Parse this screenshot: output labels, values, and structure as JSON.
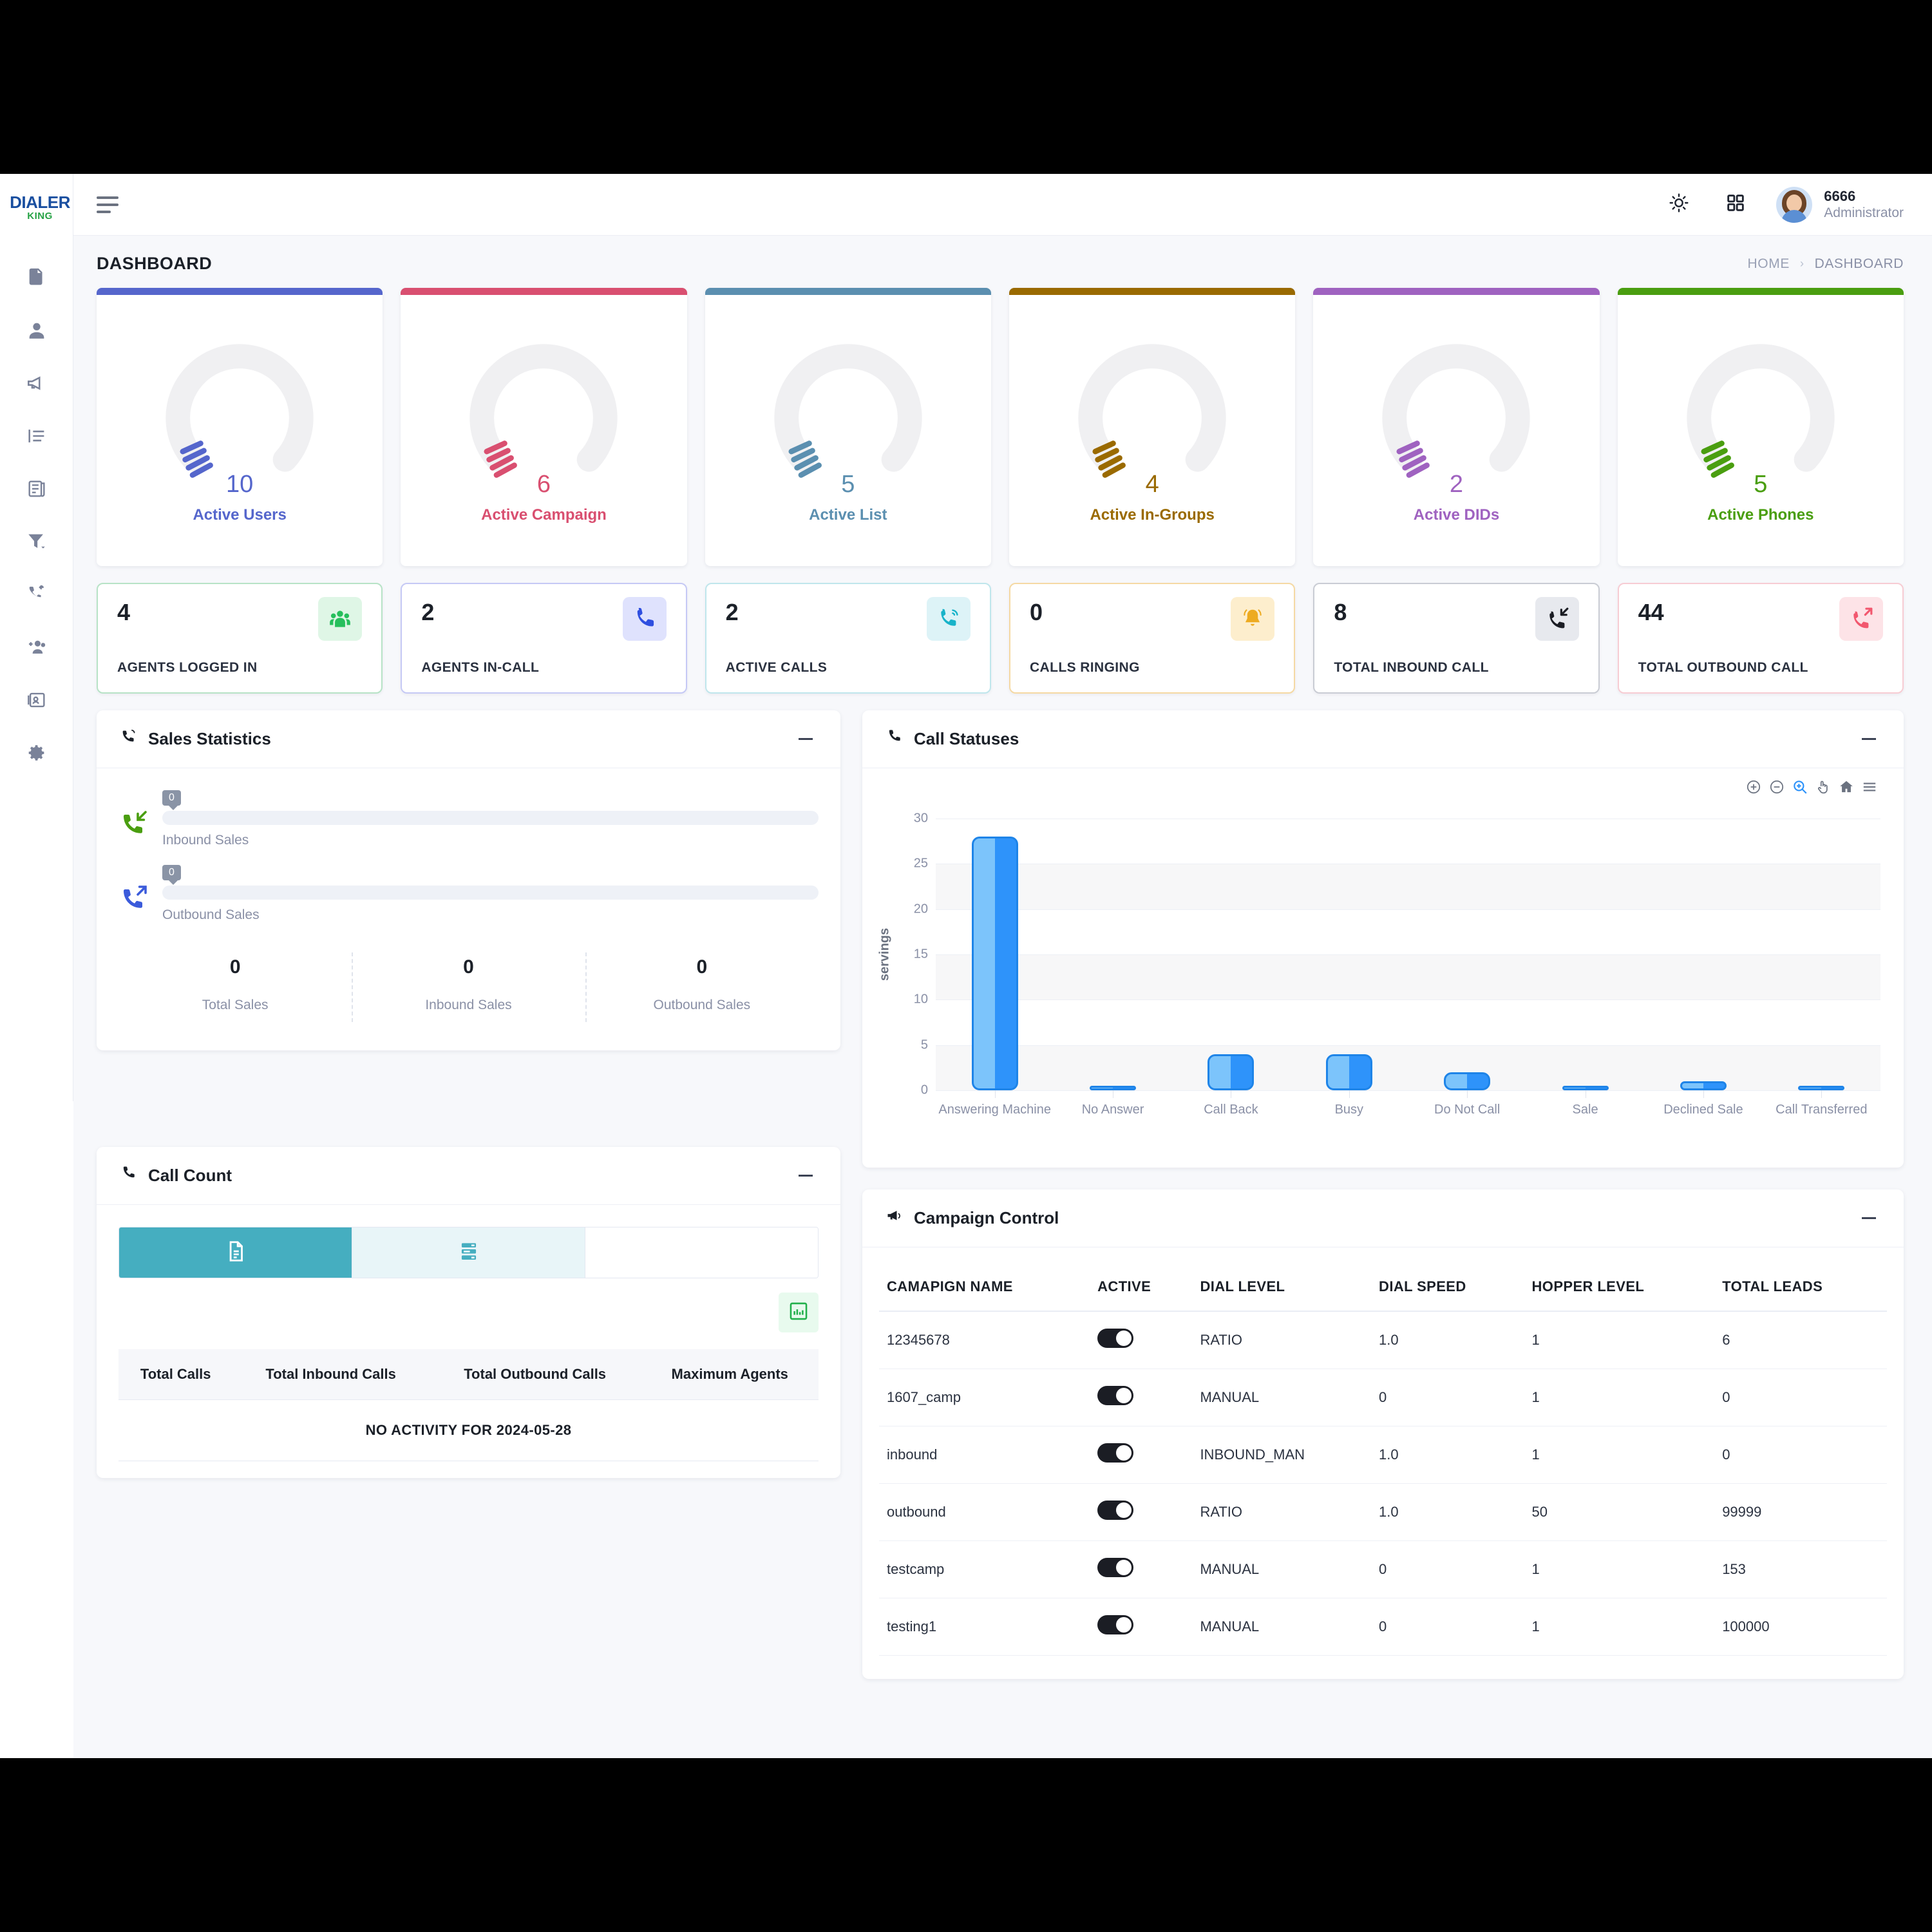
{
  "brand": {
    "main": "DIALER",
    "sub": "KING"
  },
  "sidebar": {
    "items": [
      {
        "name": "sidebar-item-reports",
        "icon": "document-icon"
      },
      {
        "name": "sidebar-item-users",
        "icon": "user-icon"
      },
      {
        "name": "sidebar-item-campaigns",
        "icon": "megaphone-icon"
      },
      {
        "name": "sidebar-item-lists",
        "icon": "list-icon"
      },
      {
        "name": "sidebar-item-scripts",
        "icon": "report-icon"
      },
      {
        "name": "sidebar-item-filters",
        "icon": "filter-icon"
      },
      {
        "name": "sidebar-item-call-transfer",
        "icon": "call-transfer-icon"
      },
      {
        "name": "sidebar-item-add-agents",
        "icon": "add-users-icon"
      },
      {
        "name": "sidebar-item-did",
        "icon": "id-card-icon"
      },
      {
        "name": "sidebar-item-settings",
        "icon": "gear-icon"
      }
    ]
  },
  "header": {
    "theme_icon": "sun-icon",
    "apps_icon": "grid-apps-icon",
    "user_name": "6666",
    "user_role": "Administrator"
  },
  "page": {
    "title": "DASHBOARD",
    "breadcrumb": {
      "home": "HOME",
      "sep": "›",
      "current": "DASHBOARD"
    }
  },
  "gauges": [
    {
      "value": "10",
      "label": "Active Users",
      "color": "#5566cc",
      "accent": "#5566cc"
    },
    {
      "value": "6",
      "label": "Active Campaign",
      "color": "#d94f70",
      "accent": "#d94f70"
    },
    {
      "value": "5",
      "label": "Active List",
      "color": "#5b8fb0",
      "accent": "#5b8fb0"
    },
    {
      "value": "4",
      "label": "Active In-Groups",
      "color": "#9a6a00",
      "accent": "#9a6a00"
    },
    {
      "value": "2",
      "label": "Active DIDs",
      "color": "#9f62c0",
      "accent": "#9f62c0"
    },
    {
      "value": "5",
      "label": "Active Phones",
      "color": "#4a9e10",
      "accent": "#4a9e10"
    }
  ],
  "kpis": [
    {
      "value": "4",
      "label": "AGENTS LOGGED IN",
      "icon": "group-icon",
      "border": "#b7e3c6",
      "badge_bg": "#dff6e6",
      "badge_fg": "#26bf5c"
    },
    {
      "value": "2",
      "label": "AGENTS IN-CALL",
      "icon": "phone-icon",
      "border": "#c5c9f5",
      "badge_bg": "#dfe2fd",
      "badge_fg": "#2f4fe0"
    },
    {
      "value": "2",
      "label": "ACTIVE CALLS",
      "icon": "phone-active-icon",
      "border": "#bfe6ec",
      "badge_bg": "#ddf3f7",
      "badge_fg": "#18b3c9"
    },
    {
      "value": "0",
      "label": "CALLS RINGING",
      "icon": "bell-icon",
      "border": "#f5d9a3",
      "badge_bg": "#fdeecd",
      "badge_fg": "#edab21"
    },
    {
      "value": "8",
      "label": "TOTAL INBOUND CALL",
      "icon": "call-inbound-icon",
      "border": "#c9ccd4",
      "badge_bg": "#e7e9ee",
      "badge_fg": "#1b1d24"
    },
    {
      "value": "44",
      "label": "TOTAL OUTBOUND CALL",
      "icon": "call-outbound-icon",
      "border": "#f7ccd3",
      "badge_bg": "#fde3e7",
      "badge_fg": "#f2586f"
    }
  ],
  "sales": {
    "title": "Sales Statistics",
    "icon": "phone-ring-icon",
    "collapse_icon": "minus-icon",
    "bars": [
      {
        "tooltip": "0",
        "label": "Inbound Sales",
        "icon": "call-inbound-green-icon"
      },
      {
        "tooltip": "0",
        "label": "Outbound Sales",
        "icon": "call-outbound-blue-icon"
      }
    ],
    "totals": [
      {
        "value": "0",
        "label": "Total Sales"
      },
      {
        "value": "0",
        "label": "Inbound Sales"
      },
      {
        "value": "0",
        "label": "Outbound Sales"
      }
    ]
  },
  "call_statuses": {
    "title": "Call Statuses",
    "icon": "phone-icon",
    "collapse_icon": "minus-icon",
    "toolbar": [
      {
        "name": "zoom-in-icon",
        "active": false
      },
      {
        "name": "zoom-out-icon",
        "active": false
      },
      {
        "name": "selection-zoom-icon",
        "active": true
      },
      {
        "name": "panning-icon",
        "active": false
      },
      {
        "name": "home-reset-icon",
        "active": false
      },
      {
        "name": "menu-icon",
        "active": false
      }
    ]
  },
  "chart_data": {
    "type": "bar",
    "title": "Call Statuses",
    "categories": [
      "Answering Machine",
      "No Answer",
      "Call Back",
      "Busy",
      "Do Not Call",
      "Sale",
      "Declined Sale",
      "Call Transferred"
    ],
    "values": [
      28,
      0,
      4,
      4,
      2,
      0,
      1,
      0
    ],
    "xlabel": "",
    "ylabel": "servings",
    "ylim": [
      0,
      30
    ],
    "yticks": [
      0,
      5,
      10,
      15,
      20,
      25,
      30
    ],
    "grid": true,
    "legend": "none",
    "bar_color": "#2e93fa"
  },
  "call_count": {
    "title": "Call Count",
    "icon": "phone-icon",
    "collapse_icon": "minus-icon",
    "tabs": [
      {
        "name": "tab-summary",
        "icon": "document-icon",
        "state": "active"
      },
      {
        "name": "tab-detail",
        "icon": "server-list-icon",
        "state": "soft"
      },
      {
        "name": "tab-blank",
        "icon": "",
        "state": "plain"
      }
    ],
    "export_icon": "excel-chart-icon",
    "columns": [
      "Total Calls",
      "Total Inbound Calls",
      "Total Outbound Calls",
      "Maximum Agents"
    ],
    "empty_message": "NO ACTIVITY FOR 2024-05-28"
  },
  "campaign_control": {
    "title": "Campaign Control",
    "icon": "megaphone-icon",
    "collapse_icon": "minus-icon",
    "columns": [
      "CAMAPIGN NAME",
      "ACTIVE",
      "DIAL LEVEL",
      "DIAL SPEED",
      "HOPPER LEVEL",
      "TOTAL LEADS"
    ],
    "rows": [
      {
        "name": "12345678",
        "active": true,
        "dial_level": "RATIO",
        "dial_speed": "1.0",
        "hopper_level": "1",
        "total_leads": "6"
      },
      {
        "name": "1607_camp",
        "active": true,
        "dial_level": "MANUAL",
        "dial_speed": "0",
        "hopper_level": "1",
        "total_leads": "0"
      },
      {
        "name": "inbound",
        "active": true,
        "dial_level": "INBOUND_MAN",
        "dial_speed": "1.0",
        "hopper_level": "1",
        "total_leads": "0"
      },
      {
        "name": "outbound",
        "active": true,
        "dial_level": "RATIO",
        "dial_speed": "1.0",
        "hopper_level": "50",
        "total_leads": "99999"
      },
      {
        "name": "testcamp",
        "active": true,
        "dial_level": "MANUAL",
        "dial_speed": "0",
        "hopper_level": "1",
        "total_leads": "153"
      },
      {
        "name": "testing1",
        "active": true,
        "dial_level": "MANUAL",
        "dial_speed": "0",
        "hopper_level": "1",
        "total_leads": "100000"
      }
    ]
  }
}
